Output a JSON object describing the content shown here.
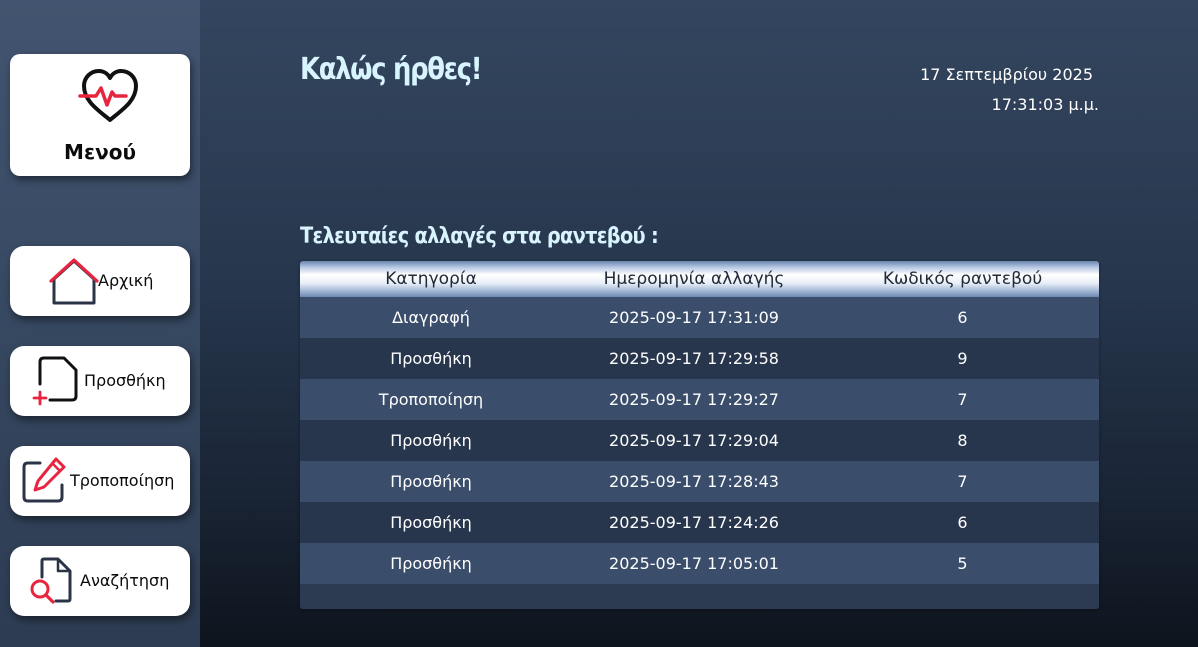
{
  "sidebar": {
    "menu": {
      "label": "Μενού",
      "icon": "heart-pulse-icon"
    },
    "nav": [
      {
        "label": "Αρχική",
        "icon": "home-icon"
      },
      {
        "label": "Προσθήκη",
        "icon": "add-document-icon"
      },
      {
        "label": "Τροποποίηση",
        "icon": "edit-icon"
      },
      {
        "label": "Αναζήτηση",
        "icon": "search-document-icon"
      }
    ]
  },
  "header": {
    "welcome": "Καλώς ήρθες!",
    "date": "17 Σεπτεμβρίου 2025",
    "time": "17:31:03 μ.μ."
  },
  "changes": {
    "title": "Τελευταίες αλλαγές στα ραντεβού :",
    "columns": [
      "Κατηγορία",
      "Ημερομηνία αλλαγής",
      "Κωδικός ραντεβού"
    ],
    "rows": [
      [
        "Διαγραφή",
        "2025-09-17 17:31:09",
        "6"
      ],
      [
        "Προσθήκη",
        "2025-09-17 17:29:58",
        "9"
      ],
      [
        "Τροποποίηση",
        "2025-09-17 17:29:27",
        "7"
      ],
      [
        "Προσθήκη",
        "2025-09-17 17:29:04",
        "8"
      ],
      [
        "Προσθήκη",
        "2025-09-17 17:28:43",
        "7"
      ],
      [
        "Προσθήκη",
        "2025-09-17 17:24:26",
        "6"
      ],
      [
        "Προσθήκη",
        "2025-09-17 17:05:01",
        "5"
      ]
    ]
  },
  "colors": {
    "accent_red": "#e8253f",
    "icon_dark": "#2b3347",
    "title_text": "#d8f4ff"
  }
}
